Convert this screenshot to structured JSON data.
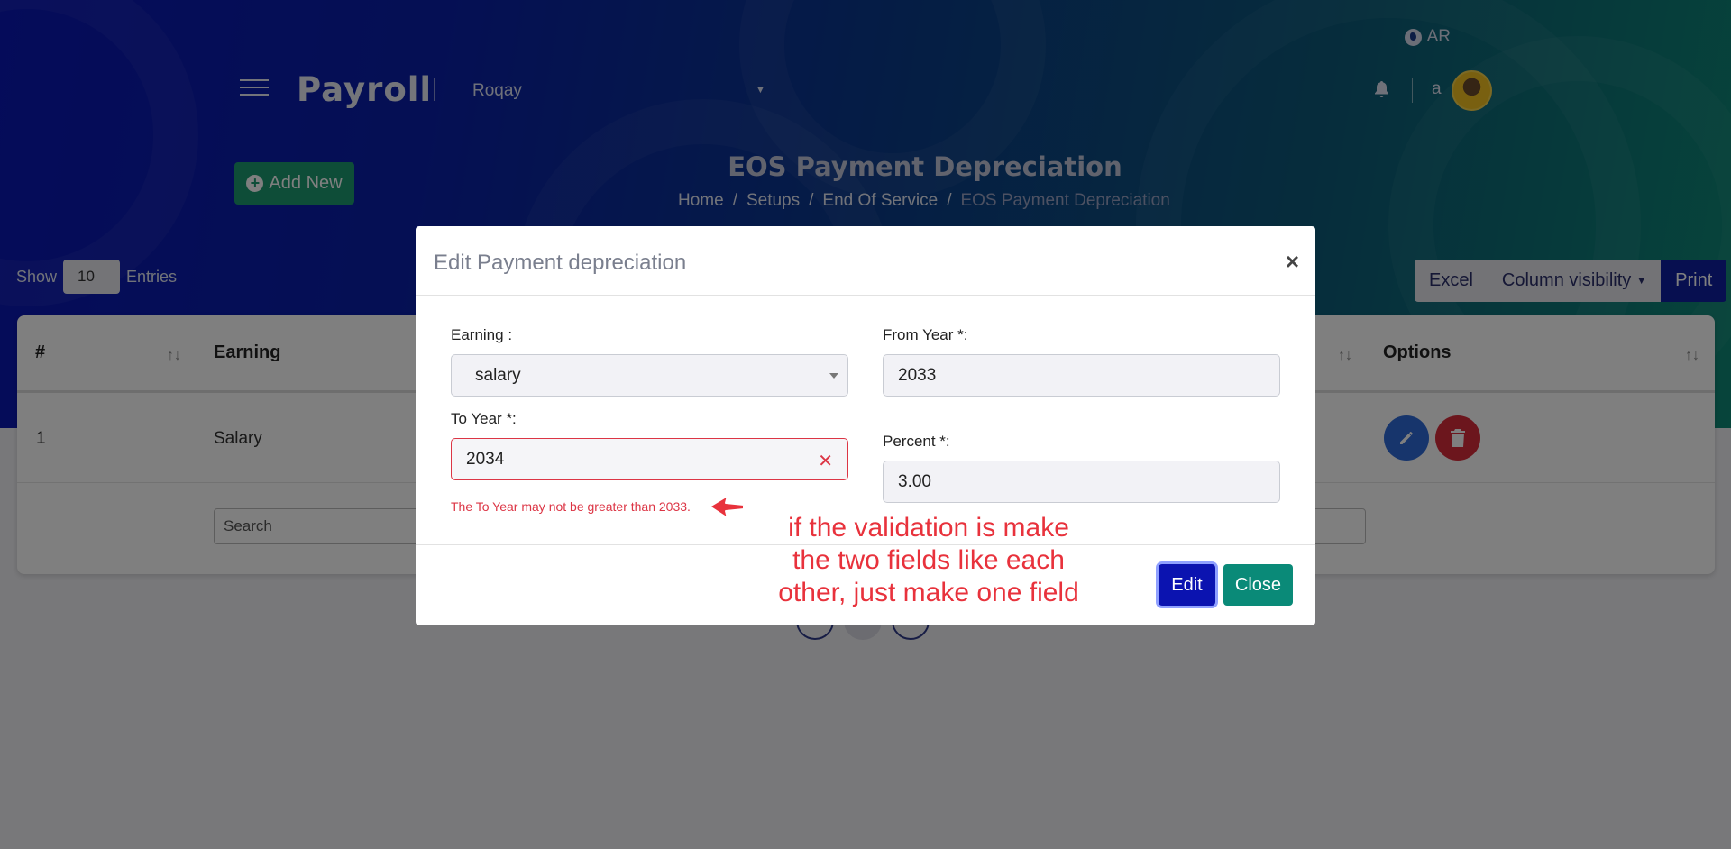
{
  "header": {
    "lang": "AR",
    "brand": "Payroll",
    "company": "Roqay",
    "username": "a"
  },
  "page": {
    "title": "EOS Payment Depreciation",
    "breadcrumb": [
      "Home",
      "Setups",
      "End Of Service",
      "EOS Payment Depreciation"
    ],
    "add_new": "Add New"
  },
  "table_controls": {
    "show": "Show",
    "entries_value": "10",
    "entries": "Entries",
    "excel": "Excel",
    "column_visibility": "Column visibility",
    "print": "Print"
  },
  "table": {
    "columns": [
      "#",
      "Earning",
      "Options"
    ],
    "rows": [
      {
        "num": "1",
        "earning": "Salary"
      }
    ],
    "search_placeholder": "Search"
  },
  "modal": {
    "title": "Edit Payment depreciation",
    "earning_label": "Earning :",
    "earning_value": "salary",
    "from_year_label": "From Year *:",
    "from_year_value": "2033",
    "to_year_label": "To Year *:",
    "to_year_value": "2034",
    "to_year_error": "The To Year may not be greater than 2033.",
    "percent_label": "Percent *:",
    "percent_value": "3.00",
    "edit_button": "Edit",
    "close_button": "Close"
  },
  "annotation": {
    "lines": [
      "if the validation is make",
      "the two fields like each",
      "other, just make one field"
    ],
    "color": "#e8323c"
  },
  "colors": {
    "brand_blue": "#0b13b0",
    "accent_green": "#1c9a71",
    "danger": "#dc3545"
  }
}
